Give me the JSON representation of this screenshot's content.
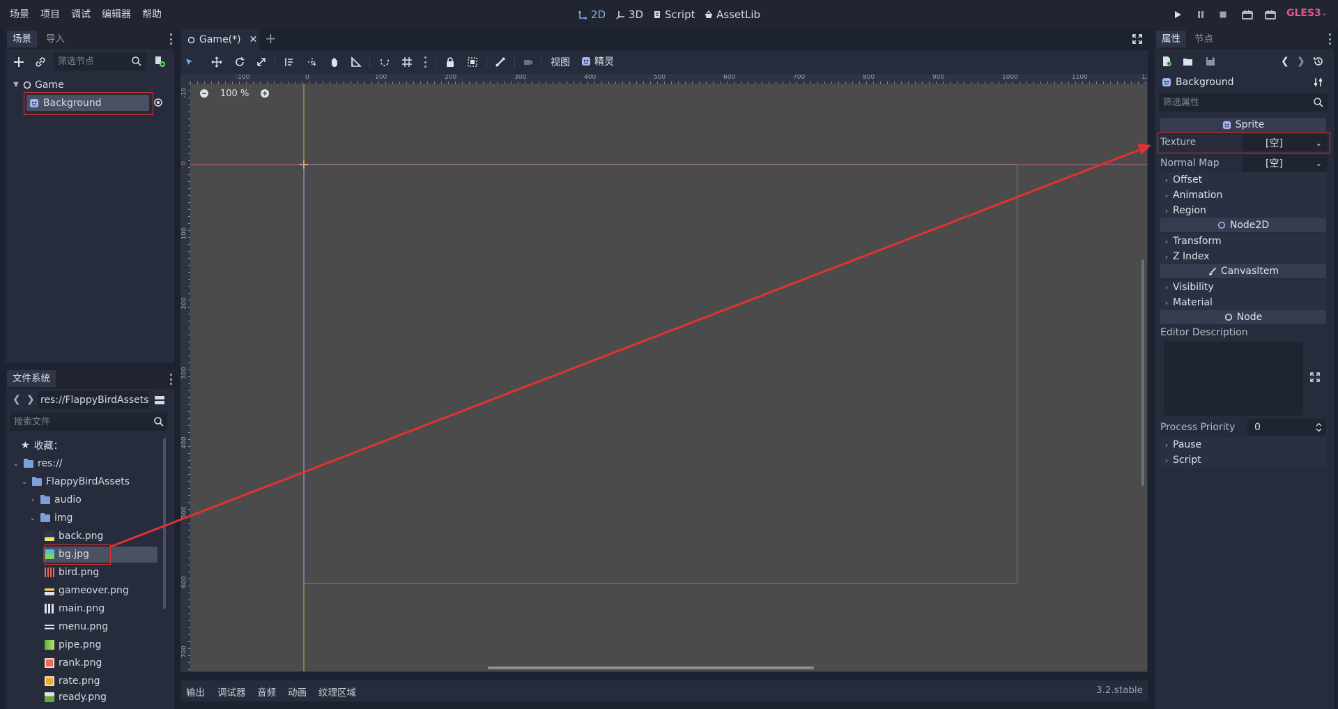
{
  "menu": {
    "items": [
      "场景",
      "项目",
      "调试",
      "编辑器",
      "帮助"
    ]
  },
  "workspaces": {
    "mode_2d": "2D",
    "mode_3d": "3D",
    "script": "Script",
    "assetlib": "AssetLib"
  },
  "renderer": {
    "label": "GLES3"
  },
  "scene_dock": {
    "tab_scene": "场景",
    "tab_import": "导入",
    "filter_placeholder": "筛选节点",
    "nodes": [
      {
        "name": "Game",
        "type": "Node2D"
      },
      {
        "name": "Background",
        "type": "Sprite",
        "selected": true
      }
    ]
  },
  "filesystem_dock": {
    "title": "文件系统",
    "path": "res://FlappyBirdAssets",
    "search_placeholder": "搜索文件",
    "favorites_label": "收藏：",
    "items": [
      {
        "label": "res://",
        "kind": "folder",
        "depth": 0,
        "expanded": true
      },
      {
        "label": "FlappyBirdAssets",
        "kind": "folder",
        "depth": 1,
        "expanded": true
      },
      {
        "label": "audio",
        "kind": "folder",
        "depth": 2,
        "expanded": false
      },
      {
        "label": "img",
        "kind": "folder",
        "depth": 2,
        "expanded": true
      },
      {
        "label": "back.png",
        "kind": "file",
        "depth": 3
      },
      {
        "label": "bg.jpg",
        "kind": "file",
        "depth": 3,
        "selected": true
      },
      {
        "label": "bird.png",
        "kind": "file",
        "depth": 3
      },
      {
        "label": "gameover.png",
        "kind": "file",
        "depth": 3
      },
      {
        "label": "main.png",
        "kind": "file",
        "depth": 3
      },
      {
        "label": "menu.png",
        "kind": "file",
        "depth": 3
      },
      {
        "label": "pipe.png",
        "kind": "file",
        "depth": 3
      },
      {
        "label": "rank.png",
        "kind": "file",
        "depth": 3
      },
      {
        "label": "rate.png",
        "kind": "file",
        "depth": 3
      },
      {
        "label": "ready.png",
        "kind": "file",
        "depth": 3
      }
    ]
  },
  "editor": {
    "scene_tab": "Game(*)",
    "menu_view": "视图",
    "menu_sprite": "精灵",
    "zoom": "100 %",
    "ruler_h_labels": [
      "-100",
      "0",
      "100",
      "200",
      "300",
      "400",
      "500",
      "600",
      "700",
      "800",
      "900",
      "1000",
      "1100",
      "12"
    ],
    "ruler_v_labels": [
      "-10",
      "0",
      "100",
      "200",
      "300",
      "400",
      "500",
      "600",
      "700"
    ]
  },
  "bottom_panel": {
    "tabs": [
      "输出",
      "调试器",
      "音频",
      "动画",
      "纹理区域"
    ],
    "version": "3.2.stable"
  },
  "inspector": {
    "tab_inspector": "属性",
    "tab_node": "节点",
    "object_name": "Background",
    "filter_placeholder": "筛选属性",
    "sections": {
      "sprite": "Sprite",
      "node2d": "Node2D",
      "canvasitem": "CanvasItem",
      "node": "Node"
    },
    "texture_label": "Texture",
    "texture_value": "[空]",
    "normal_map_label": "Normal Map",
    "normal_map_value": "[空]",
    "sprite_groups": [
      "Offset",
      "Animation",
      "Region"
    ],
    "node2d_groups": [
      "Transform",
      "Z Index"
    ],
    "canvasitem_groups": [
      "Visibility",
      "Material"
    ],
    "editor_description_label": "Editor Description",
    "process_priority_label": "Process Priority",
    "process_priority_value": "0",
    "node_groups": [
      "Pause",
      "Script"
    ]
  },
  "colors": {
    "accent": "#7aaef2",
    "annotation_red": "#e03232",
    "canvas": "#4b4b4b",
    "gles": "#e25b8c"
  }
}
